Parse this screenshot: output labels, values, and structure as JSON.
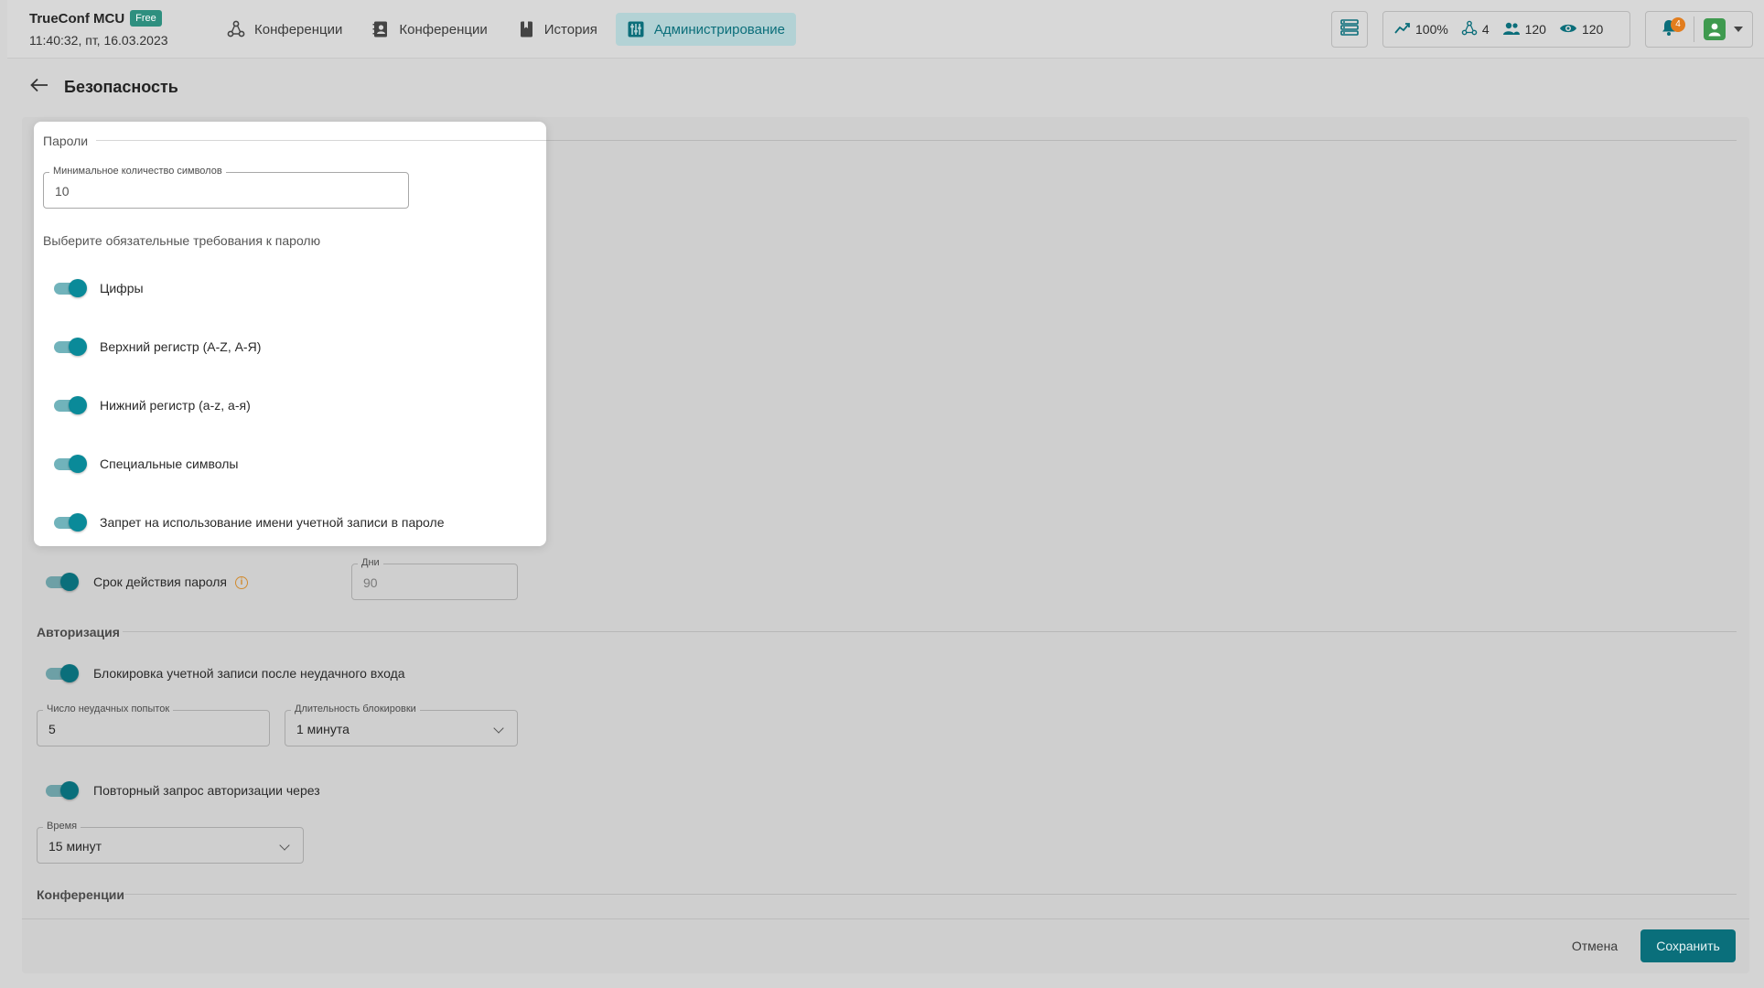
{
  "header": {
    "brand_name": "TrueConf MCU",
    "brand_badge": "Free",
    "datetime": "11:40:32, пт, 16.03.2023",
    "nav": [
      {
        "label": "Конференции",
        "icon": "conference-nodes-icon",
        "active": false
      },
      {
        "label": "Конференции",
        "icon": "address-book-icon",
        "active": false
      },
      {
        "label": "История",
        "icon": "bookmark-icon",
        "active": false
      },
      {
        "label": "Администрирование",
        "icon": "admin-sliders-icon",
        "active": true
      }
    ],
    "stats": {
      "load": "100%",
      "conferences": "4",
      "participants": "120",
      "viewers": "120"
    },
    "notifications_count": "4",
    "accent": "#0a6f7b"
  },
  "page": {
    "title": "Безопасность"
  },
  "passwords": {
    "section_label": "Пароли",
    "min_length_label": "Минимальное количество символов",
    "min_length_value": "10",
    "requirements_hint": "Выберите обязательные требования к паролю",
    "toggles": [
      {
        "label": "Цифры",
        "on": true
      },
      {
        "label": "Верхний регистр (A-Z, А-Я)",
        "on": true
      },
      {
        "label": "Нижний регистр (a-z, а-я)",
        "on": true
      },
      {
        "label": "Специальные символы",
        "on": true
      },
      {
        "label": "Запрет на использование имени учетной записи в пароле",
        "on": true
      }
    ],
    "expiry_label": "Срок действия пароля",
    "expiry_on": true,
    "days_label": "Дни",
    "days_value": "90"
  },
  "authorization": {
    "section_label": "Авторизация",
    "lockout_label": "Блокировка учетной записи после неудачного входа",
    "lockout_on": true,
    "attempts_label": "Число неудачных попыток",
    "attempts_value": "5",
    "duration_label": "Длительность блокировки",
    "duration_value": "1 минута",
    "reauth_label": "Повторный запрос авторизации через",
    "reauth_on": true,
    "time_label": "Время",
    "time_value": "15 минут"
  },
  "conferences": {
    "section_label": "Конференции"
  },
  "footer": {
    "cancel": "Отмена",
    "save": "Сохранить"
  }
}
